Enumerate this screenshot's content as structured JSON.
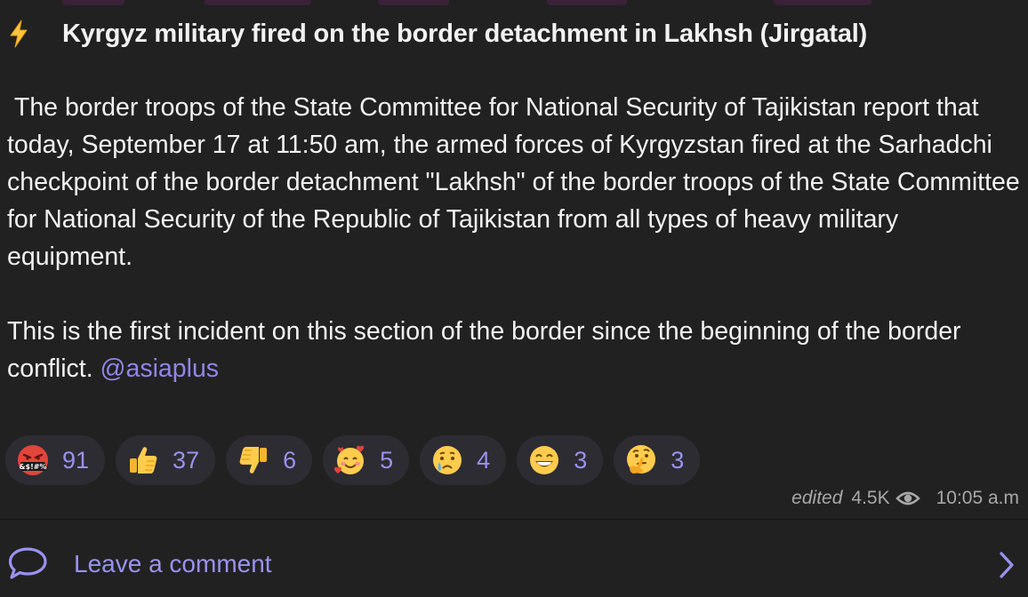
{
  "post": {
    "title": "Kyrgyz military fired on the border detachment in Lakhsh (Jirgatal)",
    "title_icon": "lightning-bolt-icon",
    "paragraph_1": " The border troops of the State Committee for National Security of Tajikistan report that today, September 17 at 11:50 am, the armed forces of Kyrgyzstan fired at the Sarhadchi checkpoint of the border detachment \"Lakhsh\" of the border troops of the State Committee for National Security of the Republic of Tajikistan from all types of heavy military equipment.",
    "paragraph_2_text": "This is the first incident on this section of the border since the beginning of the border conflict. ",
    "paragraph_2_link": "@asiaplus"
  },
  "reactions": [
    {
      "emoji": "angry-swearing-face",
      "count": "91"
    },
    {
      "emoji": "thumbs-up",
      "count": "37"
    },
    {
      "emoji": "thumbs-down",
      "count": "6"
    },
    {
      "emoji": "smiling-face-with-hearts",
      "count": "5"
    },
    {
      "emoji": "crying-face",
      "count": "4"
    },
    {
      "emoji": "beaming-grin-face",
      "count": "3"
    },
    {
      "emoji": "thinking-face",
      "count": "3"
    }
  ],
  "meta": {
    "edited_label": "edited",
    "views": "4.5K",
    "views_icon": "eye-icon",
    "time": "10:05 a.m"
  },
  "comments": {
    "label": "Leave a comment",
    "icon": "comment-bubble-icon",
    "arrow_icon": "chevron-right-icon"
  },
  "colors": {
    "background": "#212121",
    "text": "#f2f2f2",
    "accent": "#9a92f0",
    "link": "#8f86e8",
    "reaction_bg": "#2d2c33",
    "meta_text": "#a8a8a8"
  }
}
